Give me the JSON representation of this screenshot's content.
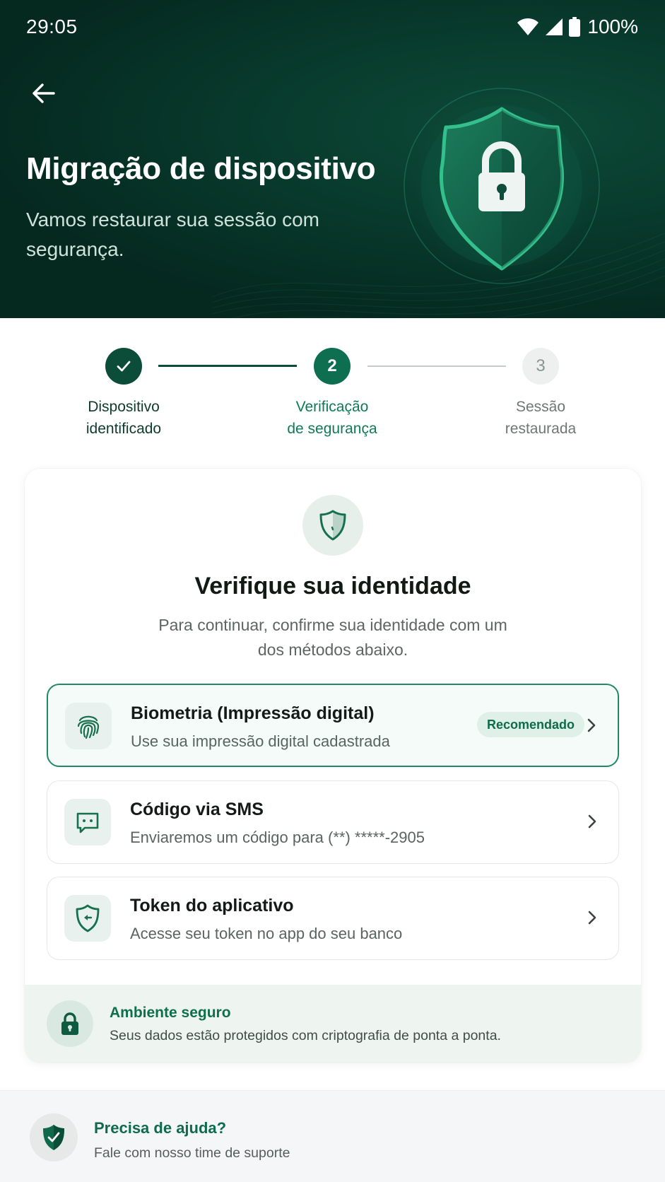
{
  "status_bar": {
    "time": "29:05",
    "battery_percent": "100%",
    "icons": [
      "wifi-icon",
      "signal-icon",
      "battery-icon"
    ]
  },
  "header": {
    "back_icon": "arrow-left-icon",
    "title": "Migração de dispositivo",
    "subtitle": "Vamos restaurar sua sessão com segurança.",
    "illustration": "shield-lock-icon"
  },
  "stepper": {
    "current_step": 2,
    "steps": [
      {
        "number": "1",
        "label_line1": "Dispositivo",
        "label_line2": "identificado",
        "state": "completed"
      },
      {
        "number": "2",
        "label_line1": "Verificação",
        "label_line2": "de segurança",
        "state": "active"
      },
      {
        "number": "3",
        "label_line1": "Sessão",
        "label_line2": "restaurada",
        "state": "pending"
      }
    ]
  },
  "verification": {
    "icon": "shield-icon",
    "title": "Verifique sua identidade",
    "subtitle": "Para continuar, confirme sua identidade com um dos métodos abaixo.",
    "methods": [
      {
        "title": "Biometria (Impressão digital)",
        "description": "Use sua impressão digital cadastrada",
        "badge": "Recomendado",
        "icon": "fingerprint-icon",
        "selected": true
      },
      {
        "title": "Código via SMS",
        "description": "Enviaremos um código para (**) *****-2905",
        "icon": "message-icon",
        "selected": false
      },
      {
        "title": "Token do aplicativo",
        "description": "Acesse seu token no app do seu banco",
        "icon": "shield-key-icon",
        "selected": false
      }
    ]
  },
  "secure_notice": {
    "icon": "lock-icon",
    "title": "Ambiente seguro",
    "description": "Seus dados estão protegidos com criptografia de ponta a ponta."
  },
  "help": {
    "icon": "shield-check-icon",
    "title": "Precisa de ajuda?",
    "description": "Fale com nosso time de suporte"
  },
  "colors": {
    "hero_bg": "#083a2c",
    "primary": "#0e6e50",
    "primary_dark": "#0c4d3a",
    "accent_light": "#e8f1ed",
    "badge_bg": "#dff0e8"
  }
}
